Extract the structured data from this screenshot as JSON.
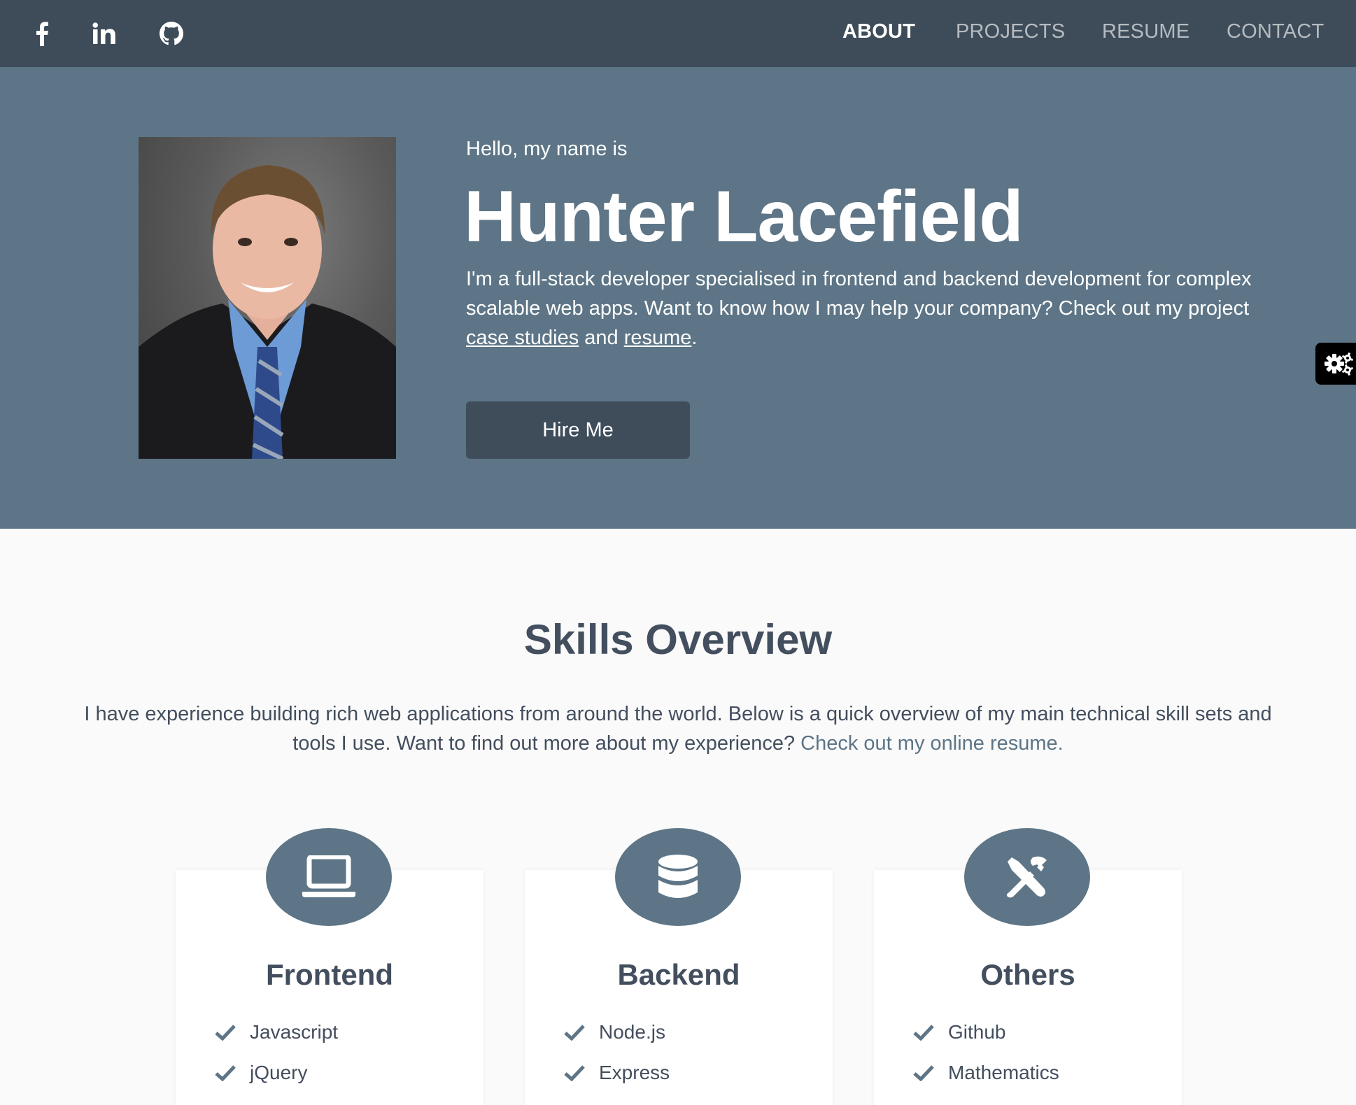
{
  "header": {
    "social": [
      {
        "name": "facebook-icon"
      },
      {
        "name": "linkedin-icon"
      },
      {
        "name": "github-icon"
      }
    ],
    "nav": [
      {
        "label": "ABOUT",
        "active": true
      },
      {
        "label": "PROJECTS",
        "active": false
      },
      {
        "label": "RESUME",
        "active": false
      },
      {
        "label": "CONTACT",
        "active": false
      }
    ]
  },
  "hero": {
    "greeting": "Hello, my name is",
    "name": "Hunter Lacefield",
    "intro_prefix": "I'm a full-stack developer specialised in frontend and backend development for complex scalable web apps. Want to know how I may help your company? Check out my project ",
    "link_case_studies": "case studies",
    "intro_and": " and ",
    "link_resume": "resume",
    "intro_suffix": ".",
    "hire_button": "Hire Me"
  },
  "skills": {
    "title": "Skills Overview",
    "intro": "I have experience building rich web applications from around the world. Below is a quick overview of my main technical skill sets and tools I use. Want to find out more about my experience? ",
    "intro_link": "Check out my online resume.",
    "cards": [
      {
        "icon": "laptop-icon",
        "title": "Frontend",
        "items": [
          "Javascript",
          "jQuery"
        ]
      },
      {
        "icon": "database-icon",
        "title": "Backend",
        "items": [
          "Node.js",
          "Express"
        ]
      },
      {
        "icon": "tools-icon",
        "title": "Others",
        "items": [
          "Github",
          "Mathematics"
        ]
      }
    ]
  },
  "colors": {
    "header_bg": "#3e4c59",
    "hero_bg": "#5d7586",
    "button_bg": "#3f4d5b",
    "text_dark": "#434e5e",
    "accent": "#5d7586"
  }
}
